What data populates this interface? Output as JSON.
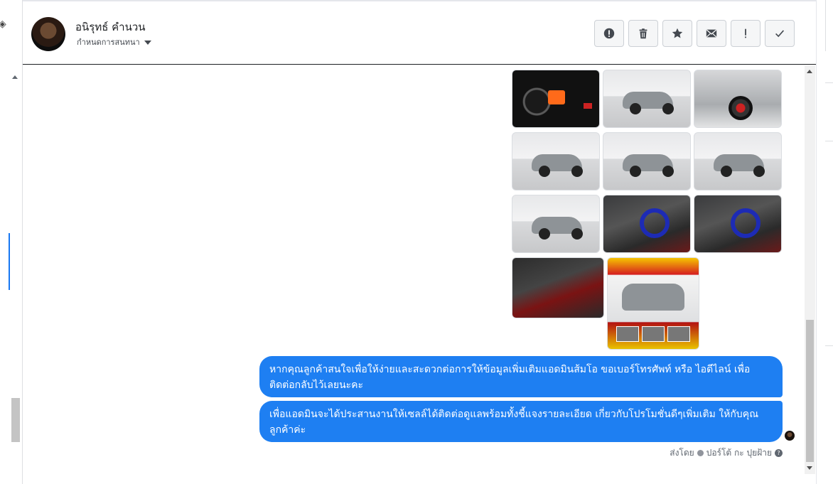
{
  "header": {
    "contact_name": "อนิรุทธ์ คำนวน",
    "subtitle": "กำหนดการสนทนา"
  },
  "actions": [
    {
      "name": "spam-icon",
      "label": "รายงานสแปม"
    },
    {
      "name": "trash-icon",
      "label": "ลบ"
    },
    {
      "name": "star-icon",
      "label": "ติดดาว"
    },
    {
      "name": "envelope-icon",
      "label": "ทำเครื่องหมายว่ายังไม่อ่าน"
    },
    {
      "name": "exclamation-icon",
      "label": "ติดตามผล"
    },
    {
      "name": "check-icon",
      "label": "เสร็จสิ้น"
    }
  ],
  "photos": [
    {
      "kind": "dashboard"
    },
    {
      "kind": "studio-side"
    },
    {
      "kind": "wheel"
    },
    {
      "kind": "studio-front"
    },
    {
      "kind": "studio-rear-quarter"
    },
    {
      "kind": "studio-rear"
    },
    {
      "kind": "studio-rear-left"
    },
    {
      "kind": "interior"
    },
    {
      "kind": "interior"
    },
    {
      "kind": "console"
    },
    {
      "kind": "poster"
    }
  ],
  "messages": [
    {
      "text": "หากคุณลูกค้าสนใจเพื่อให้ง่ายและสะดวกต่อการให้ข้อมูลเพิ่มเติมแอดมินส้มโอ ขอเบอร์โทรศัพท์ หรือ ไอดีไลน์ เพื่อติดต่อกลับไว้เลยนะคะ"
    },
    {
      "text": "เพื่อแอดมินจะได้ประสานงานให้เซลล์ได้ติดต่อดูแลพร้อมทั้งชี้แจงรายละเอียด เกี่ยวกับโปรโมชั่นดีๆเพิ่มเติม ให้กับคุณลูกค้าค่ะ"
    }
  ],
  "footer": {
    "sent_by_label": "ส่งโดย",
    "sender_name": "ปอร์โต้ กะ ปุยฝ้าย"
  },
  "colors": {
    "bubble": "#1e7ff2",
    "accent": "#1877f2"
  }
}
